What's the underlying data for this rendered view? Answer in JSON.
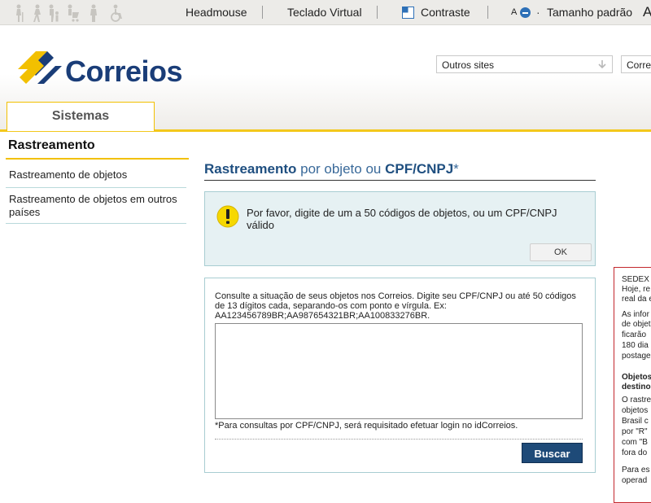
{
  "topbar": {
    "headmouse": "Headmouse",
    "teclado": "Teclado Virtual",
    "contraste": "Contraste",
    "font_small": "A",
    "font_dot": "·",
    "tamanho": "Tamanho padrão",
    "font_big": "A"
  },
  "header": {
    "logo_text": "Correios",
    "outros_sites": "Outros sites",
    "correios_select": "Correi"
  },
  "tabs": {
    "sistemas": "Sistemas"
  },
  "nav": {
    "title": "Rastreamento",
    "items": [
      {
        "label": "Rastreamento de objetos"
      },
      {
        "label": "Rastreamento de objetos em outros países"
      }
    ]
  },
  "main": {
    "title_part1": "Rastreamento",
    "title_part2": "por objeto ou",
    "title_part3": "CPF/CNPJ",
    "title_part4": "*",
    "alert_message": "Por favor, digite de um a 50 códigos de objetos, ou um CPF/CNPJ válido",
    "ok_label": "OK",
    "query_instructions": "Consulte a situação de seus objetos nos Correios. Digite seu CPF/CNPJ ou até 50 códigos de 13 dígitos cada, separando-os com ponto e vírgula. Ex: AA123456789BR;AA987654321BR;AA100833276BR.",
    "query_value": "",
    "query_note": "*Para consultas por CPF/CNPJ, será requisitado efetuar login no idCorreios.",
    "buscar_label": "Buscar"
  },
  "info_panel": {
    "lines": [
      "SEDEX",
      "Hoje, re",
      "real da e",
      "As infor",
      "de objet",
      "ficarão",
      "180 dia",
      "postage",
      "Objetos",
      "destino",
      "O rastre",
      "objetos",
      "Brasil c",
      "por \"R\"",
      "com \"B",
      "fora do",
      "Para es",
      "operad"
    ]
  },
  "colors": {
    "brand_blue": "#1a3d78",
    "brand_yellow": "#f2c000",
    "button_blue": "#1e4a78",
    "alert_bg": "#e6f1f3",
    "alert_border": "#a8cdd2",
    "info_border": "#c3282d"
  }
}
